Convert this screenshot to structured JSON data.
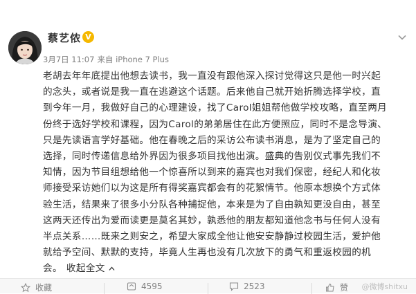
{
  "post": {
    "author": {
      "name": "蔡艺侬",
      "verified_badge": "V",
      "avatar_icon": "avatar-photo"
    },
    "meta": {
      "time": "3月7日 11:07",
      "source": "来自 iPhone 7 Plus"
    },
    "content_lines": [
      "老胡去年年底提出他想去读书，我一直没有跟他深入探讨觉得这只是他一时兴起",
      "的念头，或者说是我一直在逃避这个话题。后来他自己就开始折腾选择学校，直",
      "到今年一月，我做好自己的心理建设，找了Carol姐姐帮他做学校攻略，直至两月",
      "份终于选好学校和课程，因为Carol的弟弟居住在此方便照应，同时不是念导演、",
      "只是先读语言学好基础。他在春晚之后的采访公布读书消息，是为了坚定自己的",
      "选择，同时传递信息给外界因为很多项目找他出演。盛典的告别仪式事先我们不",
      "知情，因为节目组想给他一个惊喜所以到来的嘉宾也对我们保密，经纪人和化妆",
      "师接受采访她们以为这是所有得奖嘉宾都会有的花絮情节。他原本想换个方式体",
      "验生活，结果来了很多小分队各种捕捉他，本来是为了自由孰知更没自由，甚至",
      "这两天还传出为爱而读更是莫名其妙，孰悉他的朋友都知道他念书与任何人没有",
      "半点关系……既来之则安之，希望大家成全他让他安安静静过校园生活，爱护他",
      "就给予空间、默默的支持，毕竟人生再也没有几次放下的勇气和重返校园的机"
    ],
    "content_last_line": "会。",
    "collapse_label": "收起全文",
    "actions": {
      "favorite_label": "收藏",
      "repost_count": "4595",
      "comment_count": "2523",
      "like_label": "赞"
    },
    "watermark": "@微博shitxu"
  },
  "colors": {
    "text": "#333333",
    "meta": "#808080",
    "badge": "#f5b800",
    "action_bar": "#f7f7f7"
  }
}
